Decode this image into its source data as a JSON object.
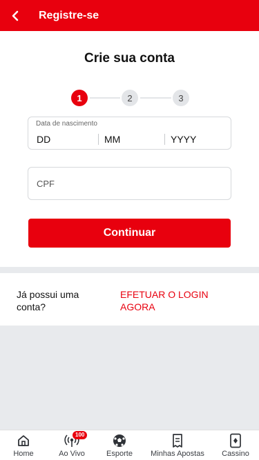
{
  "header": {
    "title": "Registre-se"
  },
  "page": {
    "title": "Crie sua conta"
  },
  "stepper": {
    "steps": [
      "1",
      "2",
      "3"
    ],
    "active_step": 1
  },
  "form": {
    "birthdate_label": "Data de nascimento",
    "day_placeholder": "DD",
    "month_placeholder": "MM",
    "year_placeholder": "YYYY",
    "cpf_placeholder": "CPF",
    "continue_label": "Continuar"
  },
  "login": {
    "question": "Já possui uma conta?",
    "link": "EFETUAR O LOGIN AGORA"
  },
  "bottom_nav": {
    "items": [
      {
        "label": "Home",
        "icon": "home-icon"
      },
      {
        "label": "Ao Vivo",
        "icon": "live-broadcast-icon",
        "badge": "100"
      },
      {
        "label": "Esporte",
        "icon": "soccer-ball-icon"
      },
      {
        "label": "Minhas Apostas",
        "icon": "bet-slip-icon"
      },
      {
        "label": "Cassino",
        "icon": "casino-card-icon"
      }
    ]
  },
  "colors": {
    "accent": "#e8000e",
    "background": "#e8eaed"
  }
}
